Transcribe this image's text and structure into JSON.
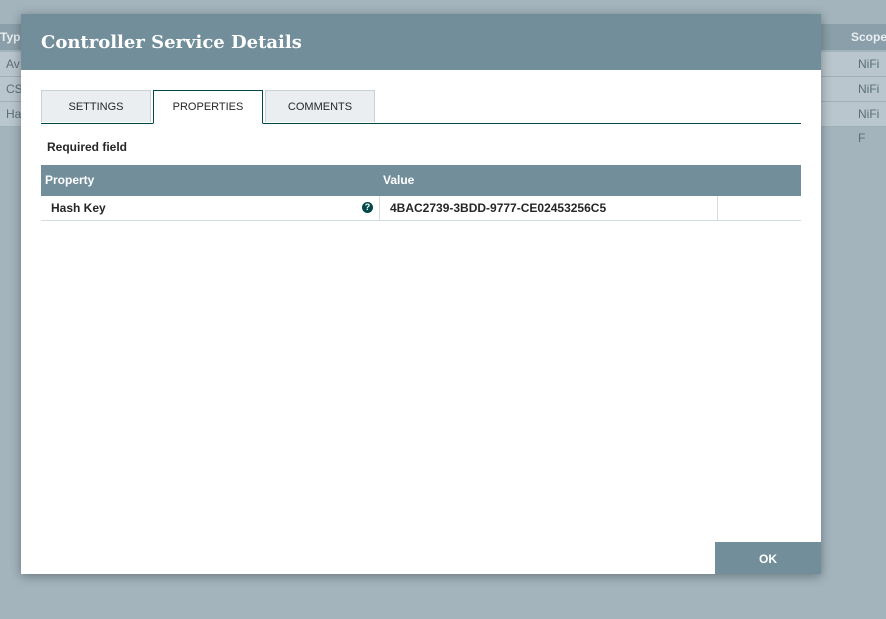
{
  "background_table": {
    "headers": {
      "type": "Type",
      "scope": "Scope"
    },
    "rows": [
      {
        "type": "Av",
        "scope": "NiFi F"
      },
      {
        "type": "CS",
        "scope": "NiFi F"
      },
      {
        "type": "Ha",
        "scope": "NiFi F"
      }
    ]
  },
  "dialog": {
    "title": "Controller Service Details",
    "tabs": [
      {
        "label": "SETTINGS",
        "active": false
      },
      {
        "label": "PROPERTIES",
        "active": true
      },
      {
        "label": "COMMENTS",
        "active": false
      }
    ],
    "required_label": "Required field",
    "properties_table": {
      "headers": {
        "property": "Property",
        "value": "Value"
      },
      "rows": [
        {
          "property": "Hash Key",
          "help_icon": "help-icon",
          "value": "4BAC2739-3BDD-9777-CE02453256C5"
        }
      ]
    },
    "ok_label": "OK"
  },
  "colors": {
    "header": "#728e9b",
    "tab_border": "#004849",
    "overlay": "#a3b4bd"
  }
}
